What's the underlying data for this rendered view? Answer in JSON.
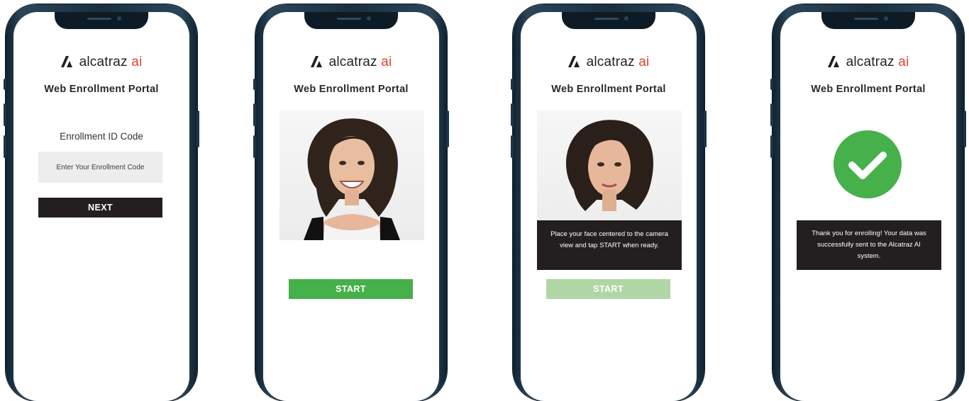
{
  "brand": {
    "logo_name": "alcatraz",
    "logo_suffix": "ai",
    "portal_title": "Web Enrollment Portal",
    "accent": "#e2412b"
  },
  "screens": [
    {
      "id": "enroll-code",
      "field_label": "Enrollment ID Code",
      "input_placeholder": "Enter Your Enrollment Code",
      "input_value": "",
      "button_label": "NEXT"
    },
    {
      "id": "capture-ready",
      "button_label": "START",
      "button_color": "#46b04b"
    },
    {
      "id": "capture-instructions",
      "instruction_text": "Place your face centered to the camera view and tap START when ready.",
      "button_label": "START",
      "button_state": "disabled",
      "button_color": "#b1d6a6"
    },
    {
      "id": "success",
      "icon": "checkmark-icon",
      "message": "Thank you for enrolling! Your data was successfully sent to the Alcatraz AI system.",
      "icon_color": "#46b04b"
    }
  ]
}
